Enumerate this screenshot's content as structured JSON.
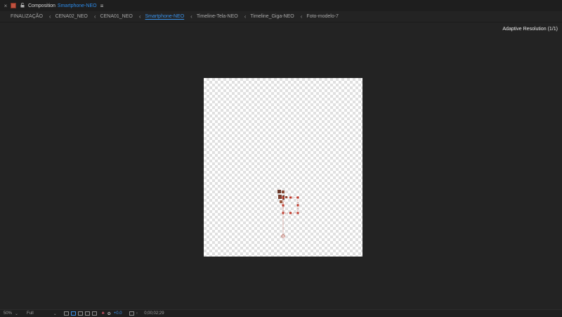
{
  "panel": {
    "close_glyph": "×",
    "lock_glyph": "🔓",
    "label": "Composition",
    "name": "Smartphone-NEO",
    "menu_glyph": "≡"
  },
  "breadcrumbs": [
    {
      "label": "FINALIZAÇÃO"
    },
    {
      "label": "CENA02_NEO"
    },
    {
      "label": "CENA01_NEO"
    },
    {
      "label": "Smartphone-NEO",
      "active": true
    },
    {
      "label": "Timeline-Tela-NEO"
    },
    {
      "label": "Timeline_Giga-NEO"
    },
    {
      "label": "Foto-modelo-7"
    }
  ],
  "separator_glyph": "‹",
  "viewer": {
    "adaptive_resolution": "Adaptive Resolution (1/1)"
  },
  "statusbar": {
    "zoom": "50%",
    "resolution": "Full",
    "exposure": "+0.0",
    "timecode": "0;00;02;29"
  },
  "colors": {
    "accent": "#2d8ceb",
    "handle": "#c0392b",
    "layer": "#7a4a3a"
  }
}
